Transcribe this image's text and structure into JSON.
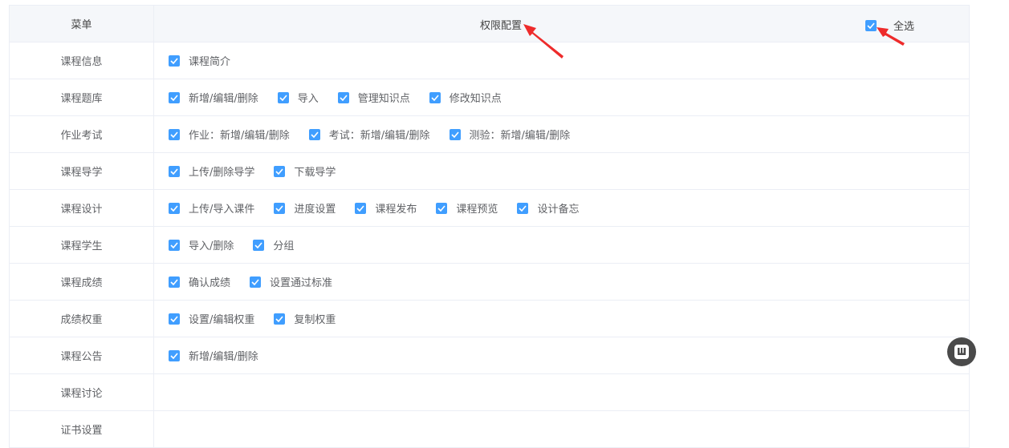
{
  "header": {
    "menu_col": "菜单",
    "perm_col": "权限配置",
    "select_all_label": "全选"
  },
  "rows": [
    {
      "menu": "课程信息",
      "options": [
        "课程简介"
      ]
    },
    {
      "menu": "课程题库",
      "options": [
        "新增/编辑/删除",
        "导入",
        "管理知识点",
        "修改知识点"
      ]
    },
    {
      "menu": "作业考试",
      "options": [
        "作业：新增/编辑/删除",
        "考试：新增/编辑/删除",
        "测验：新增/编辑/删除"
      ]
    },
    {
      "menu": "课程导学",
      "options": [
        "上传/删除导学",
        "下载导学"
      ]
    },
    {
      "menu": "课程设计",
      "options": [
        "上传/导入课件",
        "进度设置",
        "课程发布",
        "课程预览",
        "设计备忘"
      ]
    },
    {
      "menu": "课程学生",
      "options": [
        "导入/删除",
        "分组"
      ]
    },
    {
      "menu": "课程成绩",
      "options": [
        "确认成绩",
        "设置通过标准"
      ]
    },
    {
      "menu": "成绩权重",
      "options": [
        "设置/编辑权重",
        "复制权重"
      ]
    },
    {
      "menu": "课程公告",
      "options": [
        "新增/编辑/删除"
      ]
    },
    {
      "menu": "课程讨论",
      "options": []
    },
    {
      "menu": "证书设置",
      "options": []
    }
  ],
  "colors": {
    "checkbox": "#409eff",
    "border": "#ebeef5",
    "header_bg": "#f5f7fa",
    "annotation_arrow": "#ee2b2b"
  },
  "icons": {
    "check": "check-icon",
    "float": "dock-icon"
  }
}
